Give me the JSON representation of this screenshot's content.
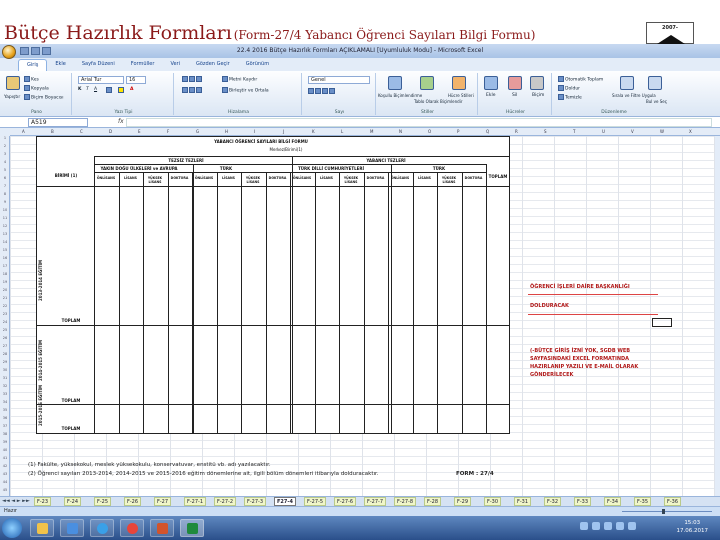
{
  "slide": {
    "title_main": "Bütçe Hazırlık Formları",
    "title_sub": "(Form-27/4 Yabancı Öğrenci Sayıları Bilgi Formu)",
    "logo_text": "2007-"
  },
  "window": {
    "title": "22.4 2016 Bütçe Hazırlık Formları AÇIKLAMALI [Uyumluluk Modu] - Microsoft Excel"
  },
  "tabs": [
    "Giriş",
    "Ekle",
    "Sayfa Düzeni",
    "Formüller",
    "Veri",
    "Gözden Geçir",
    "Görünüm"
  ],
  "ribbon": {
    "paste": "Yapıştır",
    "cut": "Kes",
    "copy": "Kopyala",
    "format_painter": "Biçim Boyacısı",
    "clipboard": "Pano",
    "font_name": "Arial Tur",
    "font_size": "16",
    "font": "Yazı Tipi",
    "wrap_text": "Metni Kaydır",
    "merge": "Birleştir ve Ortala",
    "alignment": "Hizalama",
    "number_format": "Genel",
    "number": "Sayı",
    "conditional": "Koşullu Biçimlendirme",
    "table_format": "Tablo Olarak Biçimlendir",
    "cell_styles": "Hücre Stilleri",
    "styles": "Stiller",
    "insert": "Ekle",
    "delete": "Sil",
    "format": "Biçim",
    "cells": "Hücreler",
    "autosum": "Otomatik Toplam",
    "fill": "Doldur",
    "clear": "Temizle",
    "sort_filter": "Sırala ve Filtre Uygula",
    "find_select": "Bul ve Seç",
    "editing": "Düzenleme"
  },
  "formula_bar": {
    "name_box": "A519",
    "fx": "fx",
    "content": ""
  },
  "columns": [
    "A",
    "B",
    "C",
    "D",
    "E",
    "F",
    "G",
    "H",
    "I",
    "J",
    "K",
    "L",
    "M",
    "N",
    "O",
    "P",
    "Q",
    "R",
    "S",
    "T",
    "U",
    "V",
    "W",
    "X"
  ],
  "form": {
    "heading": "YABANCI ÖĞRENCİ SAYILARI BİLGİ FORMU",
    "subheading": "Merkez/Birimi(1)",
    "tezsiz": "TEZSİZ TEZLERİ",
    "yabanci": "YABANCI TEZLERİ",
    "birim": "BİRİMİ (1)",
    "top_col_a": "YAKIN DOĞU ÜLKELERİ ve AVRUPA",
    "top_col_b": "TÜRK",
    "top_col_c": "TÜRK DİLLİ CUMHURİYETLERİ",
    "top_col_d": "TÜRK",
    "toplam": "TOPLAM",
    "sub_cols": [
      "ÖNLİSANS",
      "LİSANS",
      "YÜKSEK LİSANS",
      "DOKTORA",
      "ÖNLİSANS",
      "LİSANS",
      "YÜKSEK LİSANS",
      "DOKTORA",
      "ÖNLİSANS",
      "LİSANS",
      "YÜKSEK LİSANS",
      "DOKTORA",
      "ÖNLİSANS",
      "LİSANS",
      "YÜKSEK LİSANS",
      "DOKTORA"
    ],
    "section1": "2013-2014 EĞİTİM",
    "section2": "2014-2015 EĞİTİM",
    "section3": "2015-2016 EĞİTİM",
    "toplam_row": "TOPLAM"
  },
  "notes": {
    "note1": "ÖĞRENCİ İŞLERİ DAİRE BAŞKANLIĞI",
    "note2": "DOLDURACAK",
    "note3": "(-BÜTÇE GİRİŞ İZNİ YOK, SGDB WEB SAYFASINDAKİ EXCEL FORMATINDA HAZIRLANIP YAZILI VE E-MAİL OLARAK GÖNDERİLECEK"
  },
  "footnotes": {
    "line1": "(1) Fakülte, yüksekokul, meslek yüksekokulu, konservatuvar, enstitü vb. adı yazılacaktır.",
    "line2": "(2) Öğrenci sayıları 2013-2014, 2014-2015 ve 2015-2016 eğitim dönemlerine ait, ilgili bölüm dönemleri itibarıyla dolduracaktır.",
    "form_no": "FORM : 27/4"
  },
  "sheet_tabs": [
    "F-23",
    "F-24",
    "F-25",
    "F-26",
    "F-27",
    "F-27-1",
    "F-27-2",
    "F-27-3",
    "F27-4",
    "F-27-5",
    "F-27-6",
    "F-27-7",
    "F-27-8",
    "F-28",
    "F-29",
    "F-30",
    "F-31",
    "F-32",
    "F-33",
    "F-34",
    "F-35",
    "F-36"
  ],
  "active_sheet": "F27-4",
  "status": {
    "mode": "Hazır"
  },
  "clock": {
    "time": "15:03",
    "date": "17.06.2017"
  }
}
